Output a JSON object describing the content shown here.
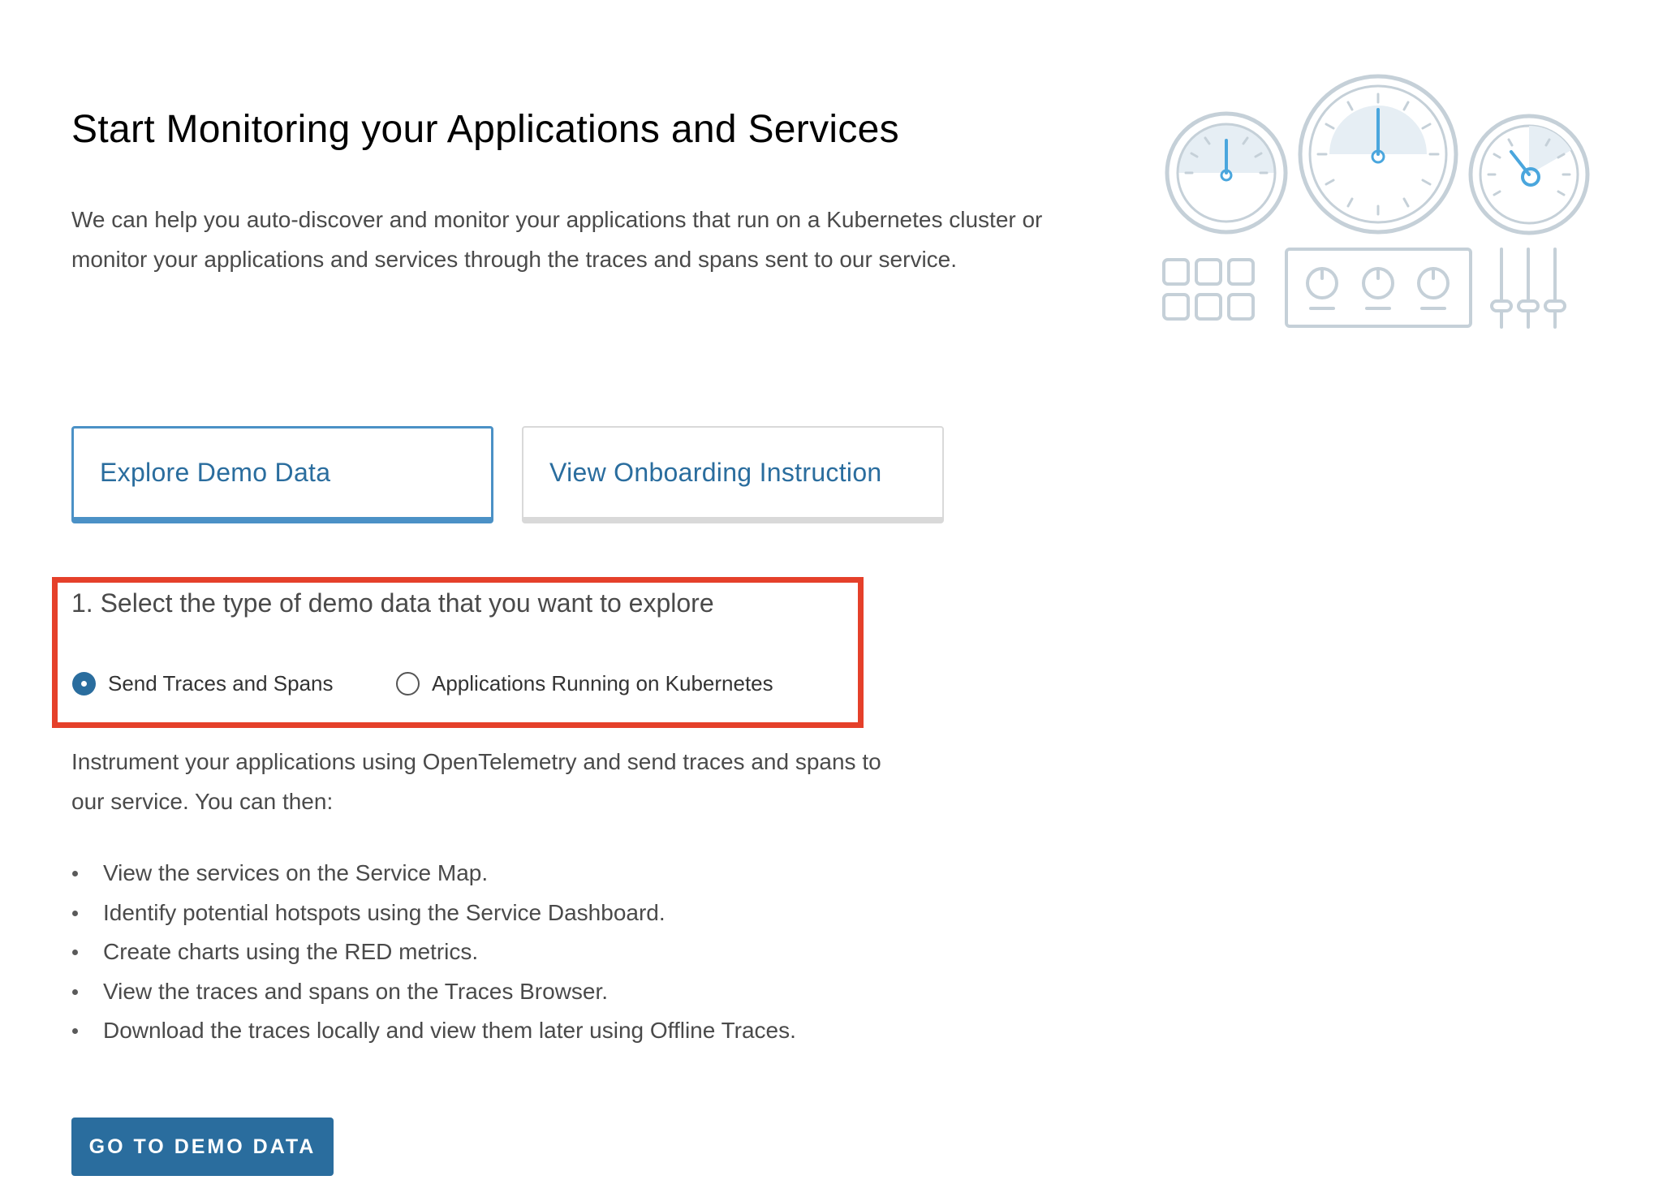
{
  "header": {
    "title": "Start Monitoring your Applications and Services",
    "intro": "We can help you auto-discover and monitor your applications that run on a Kubernetes cluster or monitor your applications and services through the traces and spans sent to our service."
  },
  "illustration": {
    "icon": "dashboard-gauges-illustration",
    "colors": {
      "outline": "#c5d0d8",
      "gauge_fill": "#e6eef4",
      "needle": "#4aa6dd"
    }
  },
  "choices": {
    "explore": {
      "label": "Explore Demo Data",
      "selected": true
    },
    "onboarding": {
      "label": "View Onboarding Instruction",
      "selected": false
    }
  },
  "step": {
    "heading": "1. Select the type of demo data that you want to explore",
    "options": [
      {
        "label": "Send Traces and Spans",
        "checked": true
      },
      {
        "label": "Applications Running on Kubernetes",
        "checked": false
      }
    ]
  },
  "details": {
    "description": "Instrument your applications using OpenTelemetry and send traces and spans to our service. You can then:",
    "items": [
      "View the services on the Service Map.",
      "Identify potential hotspots using the Service Dashboard.",
      "Create charts using the RED metrics.",
      "View the traces and spans on the Traces Browser.",
      "Download the traces locally and view them later using Offline Traces."
    ]
  },
  "action": {
    "button_label": "GO TO DEMO DATA"
  },
  "colors": {
    "primary": "#2a6d9e",
    "selected_border": "#4b91c6",
    "highlight": "#e5402a",
    "text": "#4a4a4a"
  }
}
